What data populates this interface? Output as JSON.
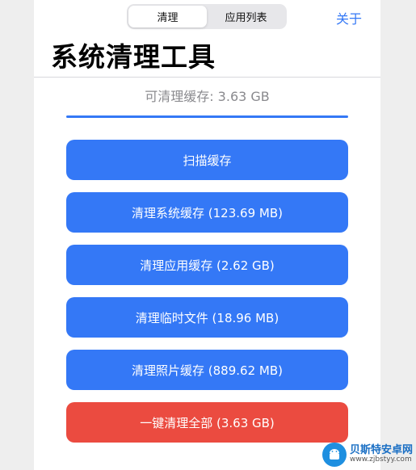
{
  "nav": {
    "tabs": [
      {
        "label": "清理",
        "active": true
      },
      {
        "label": "应用列表",
        "active": false
      }
    ],
    "about_label": "关于"
  },
  "title": "系统清理工具",
  "summary": "可清理缓存: 3.63 GB",
  "progress": {
    "fraction": 1.0,
    "color": "#3478f6"
  },
  "actions": [
    {
      "label": "扫描缓存",
      "style": "primary"
    },
    {
      "label": "清理系统缓存 (123.69 MB)",
      "style": "primary"
    },
    {
      "label": "清理应用缓存 (2.62 GB)",
      "style": "primary"
    },
    {
      "label": "清理临时文件 (18.96 MB)",
      "style": "primary"
    },
    {
      "label": "清理照片缓存 (889.62 MB)",
      "style": "primary"
    },
    {
      "label": "一键清理全部 (3.63 GB)",
      "style": "danger"
    }
  ],
  "colors": {
    "accent": "#3478f6",
    "danger": "#eb4b40"
  },
  "watermark": {
    "name": "贝斯特安卓网",
    "url": "www.zjbstyy.com",
    "icon": "android-robot-icon"
  }
}
